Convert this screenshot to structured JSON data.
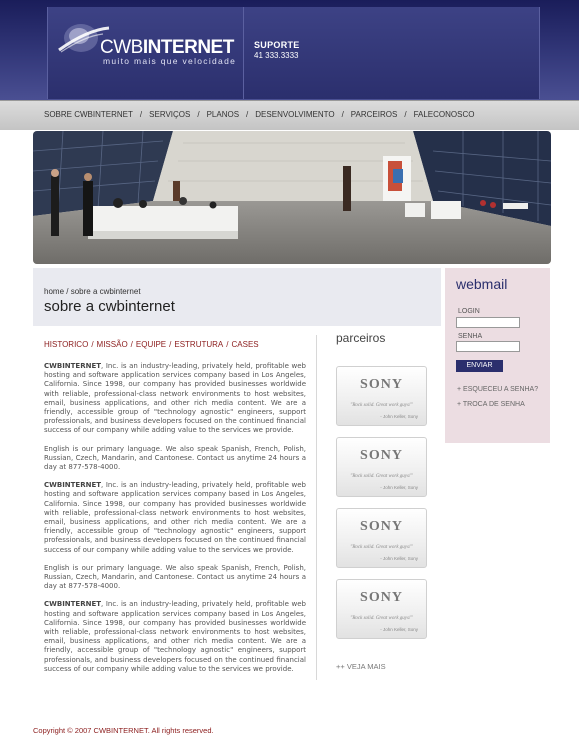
{
  "header": {
    "logo": {
      "brand_light": "CWB",
      "brand_bold": "INTERNET",
      "tagline": "muito mais que velocidade"
    },
    "support": {
      "title": "SUPORTE",
      "phone": "41 333.3333"
    }
  },
  "nav": {
    "items": [
      "SOBRE CWBINTERNET",
      "SERVIÇOS",
      "PLANOS",
      "DESENVOLVIMENTO",
      "PARCEIROS",
      "FALECONOSCO"
    ],
    "separator": "/"
  },
  "breadcrumb": {
    "home": "home",
    "separator": "/",
    "current": "sobre a cwbinternet"
  },
  "page_title": "sobre a cwbinternet",
  "subnav": {
    "items": [
      "HISTORICO",
      "MISSÃO",
      "EQUIPE",
      "ESTRUTURA",
      "CASES"
    ],
    "separator": "/"
  },
  "content": {
    "company": "CWBINTERNET",
    "para_main": ", Inc. is an industry-leading, privately held, profitable web hosting and software application services company based in Los Angeles, California. Since 1998, our company has provided businesses worldwide with reliable, professional-class network environments to host websites, email, business applications, and other rich media content. We are a friendly, accessible group of \"technology agnostic\" engineers, support professionals, and business developers focused on the continued financial success of our company while adding value to the services we provide.",
    "para_lang": "English is our primary language. We also speak Spanish, French, Polish, Russian, Czech, Mandarin, and Cantonese. Contact us anytime 24 hours a day at 877-578-4000."
  },
  "partners": {
    "title": "parceiros",
    "items": [
      {
        "brand": "SONY",
        "quote": "\"Rock solid. Great work guys!\"",
        "author": "- John Keller, Sony"
      },
      {
        "brand": "SONY",
        "quote": "\"Rock solid. Great work guys!\"",
        "author": "- John Keller, Sony"
      },
      {
        "brand": "SONY",
        "quote": "\"Rock solid. Great work guys!\"",
        "author": "- John Keller, Sony"
      },
      {
        "brand": "SONY",
        "quote": "\"Rock solid. Great work guys!\"",
        "author": "- John Keller, Sony"
      }
    ],
    "see_more": "++ VEJA MAIS"
  },
  "webmail": {
    "title": "webmail",
    "login_label": "LOGIN",
    "login_value": "",
    "password_label": "SENHA",
    "password_value": "",
    "submit_label": "ENVIAR",
    "forgot_link": "+ ESQUECEU A SENHA?",
    "change_link": "+ TROCA DE SENHA"
  },
  "footer": {
    "copyright": "Copyright © 2007 CWBINTERNET.  All rights reserved."
  },
  "colors": {
    "header": "#2b2f6d",
    "accent": "#8b1c1c",
    "webmail_bg": "#ecdde2"
  }
}
